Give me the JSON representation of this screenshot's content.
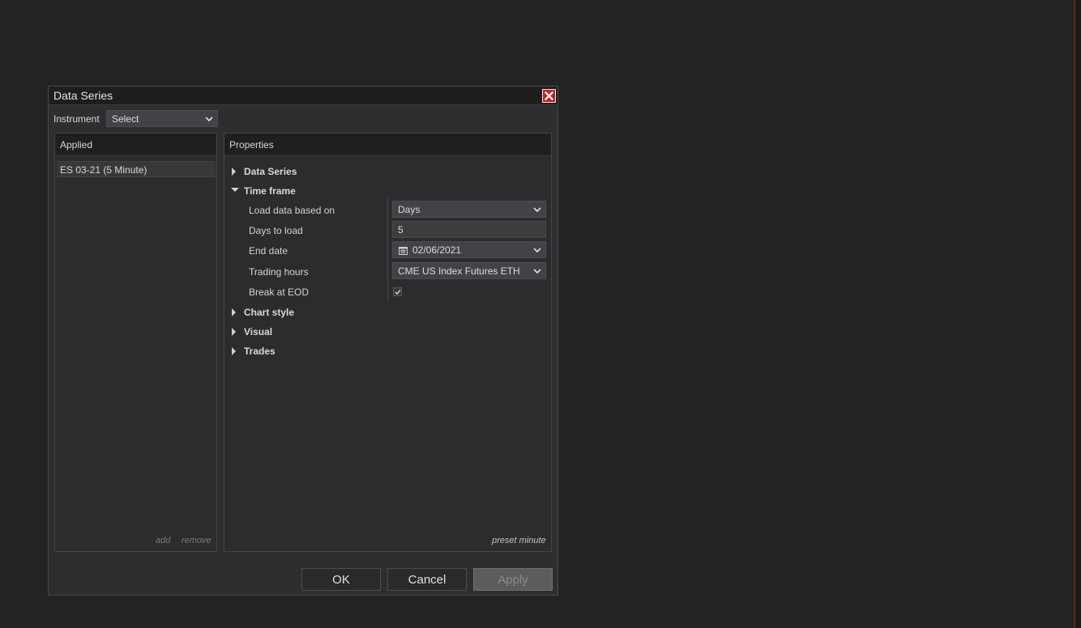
{
  "dialog": {
    "title": "Data Series",
    "close_icon": "close-icon"
  },
  "instrument": {
    "label": "Instrument",
    "selected": "Select"
  },
  "applied": {
    "header": "Applied",
    "items": [
      "ES 03-21 (5 Minute)"
    ],
    "add_label": "add",
    "remove_label": "remove"
  },
  "properties": {
    "header": "Properties",
    "sections": {
      "data_series": "Data Series",
      "time_frame": "Time frame",
      "chart_style": "Chart style",
      "visual": "Visual",
      "trades": "Trades"
    },
    "time_frame": {
      "load_data_label": "Load data based on",
      "load_data_value": "Days",
      "days_to_load_label": "Days to load",
      "days_to_load_value": "5",
      "end_date_label": "End date",
      "end_date_value": "02/06/2021",
      "trading_hours_label": "Trading hours",
      "trading_hours_value": "CME US Index Futures ETH",
      "break_eod_label": "Break at EOD",
      "break_eod_checked": true
    },
    "preset_label": "preset minute"
  },
  "buttons": {
    "ok": "OK",
    "cancel": "Cancel",
    "apply": "Apply"
  },
  "colors": {
    "background": "#232323",
    "dialog": "#2e2e30",
    "close_red": "#c42424"
  }
}
